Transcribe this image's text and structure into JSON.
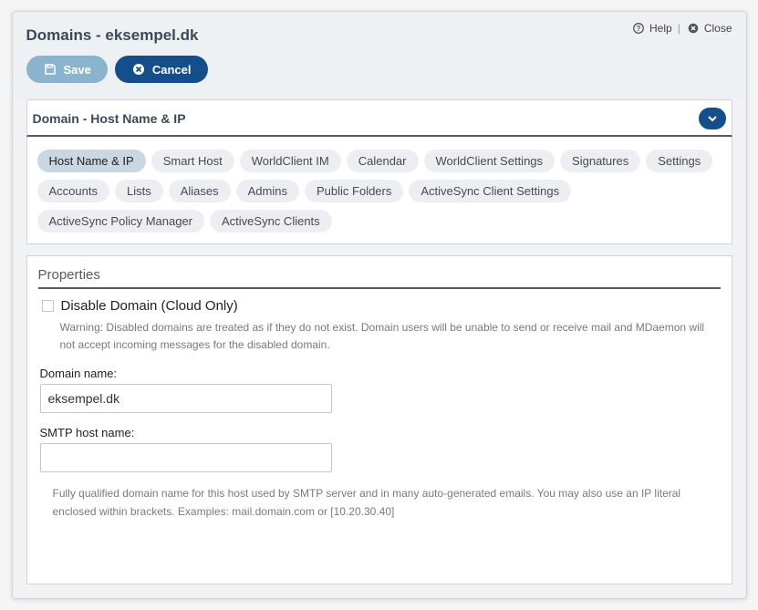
{
  "header": {
    "title": "Domains - eksempel.dk",
    "help": "Help",
    "close": "Close"
  },
  "toolbar": {
    "save_label": "Save",
    "cancel_label": "Cancel"
  },
  "section": {
    "title": "Domain - Host Name & IP"
  },
  "tabs": [
    "Host Name & IP",
    "Smart Host",
    "WorldClient IM",
    "Calendar",
    "WorldClient Settings",
    "Signatures",
    "Settings",
    "Accounts",
    "Lists",
    "Aliases",
    "Admins",
    "Public Folders",
    "ActiveSync Client Settings",
    "ActiveSync Policy Manager",
    "ActiveSync Clients"
  ],
  "active_tab_index": 0,
  "panel": {
    "heading": "Properties",
    "disable_label": "Disable Domain (Cloud Only)",
    "disable_checked": false,
    "disable_hint": "Warning: Disabled domains are treated as if they do not exist. Domain users will be unable to send or receive mail and MDaemon will not accept incoming messages for the disabled domain.",
    "domain_name_label": "Domain name:",
    "domain_name_value": "eksempel.dk",
    "smtp_host_label": "SMTP host name:",
    "smtp_host_value": "",
    "smtp_host_hint": "Fully qualified domain name for this host used by SMTP server and in many auto-generated emails. You may also use an IP literal enclosed within brackets. Examples: mail.domain.com or [10.20.30.40]"
  }
}
